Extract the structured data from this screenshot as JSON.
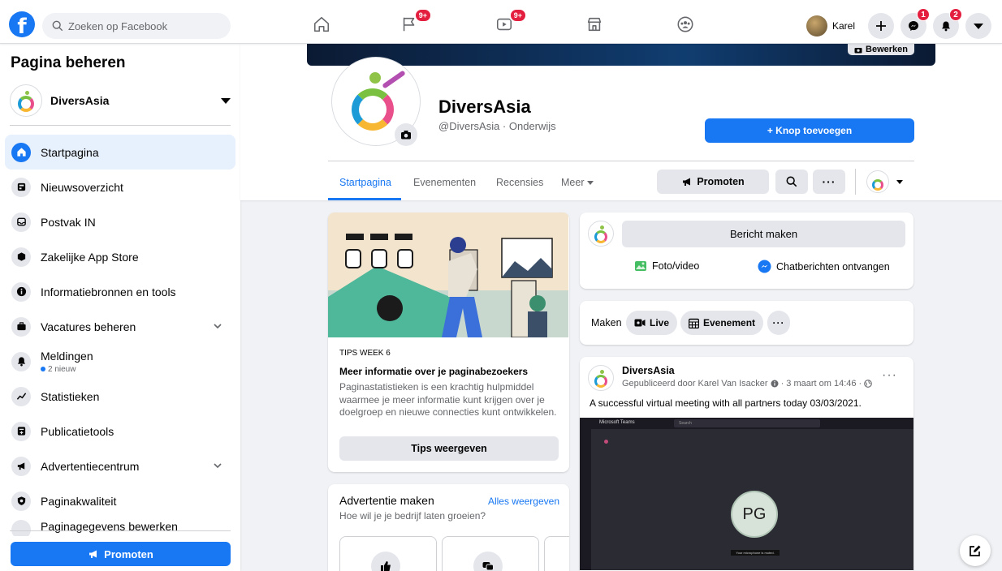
{
  "topbar": {
    "search_placeholder": "Zoeken op Facebook",
    "pages_badge": "9+",
    "watch_badge": "9+",
    "profile_name": "Karel",
    "messenger_badge": "1",
    "notifications_badge": "2"
  },
  "sidebar": {
    "title": "Pagina beheren",
    "page_name": "DiversAsia",
    "items": [
      {
        "label": "Startpagina",
        "icon": "home-icon"
      },
      {
        "label": "Nieuwsoverzicht",
        "icon": "news-feed-icon"
      },
      {
        "label": "Postvak IN",
        "icon": "inbox-icon"
      },
      {
        "label": "Zakelijke App Store",
        "icon": "app-store-icon"
      },
      {
        "label": "Informatiebronnen en tools",
        "icon": "info-icon"
      },
      {
        "label": "Vacatures beheren",
        "icon": "briefcase-icon"
      },
      {
        "label": "Meldingen",
        "icon": "bell-icon",
        "sub": "2 nieuw"
      },
      {
        "label": "Statistieken",
        "icon": "stats-icon"
      },
      {
        "label": "Publicatietools",
        "icon": "publishing-icon"
      },
      {
        "label": "Advertentiecentrum",
        "icon": "megaphone-icon"
      },
      {
        "label": "Paginakwaliteit",
        "icon": "shield-icon"
      },
      {
        "label": "Paginagegevens bewerken",
        "icon": "edit-icon"
      }
    ],
    "promote_label": "Promoten"
  },
  "header": {
    "cover_edit_label": "Bewerken",
    "page_name": "DiversAsia",
    "page_handle": "@DiversAsia · Onderwijs",
    "add_button_label": "+ Knop toevoegen",
    "tabs": [
      "Startpagina",
      "Evenementen",
      "Recensies",
      "Meer"
    ],
    "promote_label": "Promoten"
  },
  "tips": {
    "kicker": "TIPS WEEK 6",
    "title": "Meer informatie over je paginabezoekers",
    "body": "Paginastatistieken is een krachtig hulpmiddel waarmee je meer informatie kunt krijgen over je doelgroep en nieuwe connecties kunt ontwikkelen.",
    "button": "Tips weergeven"
  },
  "ad": {
    "title": "Advertentie maken",
    "link": "Alles weergeven",
    "subtitle": "Hoe wil je je bedrijf laten groeien?"
  },
  "composer": {
    "button": "Bericht maken",
    "photo_label": "Foto/video",
    "chat_label": "Chatberichten ontvangen"
  },
  "create": {
    "label": "Maken",
    "live": "Live",
    "event": "Evenement"
  },
  "post": {
    "author": "DiversAsia",
    "meta": "Gepubliceerd door Karel Van Isacker",
    "date": "· 3 maart om 14:46 ·",
    "text": "A successful virtual meeting with all partners today 03/03/2021.",
    "teams_title": "Microsoft Teams",
    "teams_search": "Search",
    "initials": "PG",
    "mic_note": "Your microphone is muted."
  }
}
